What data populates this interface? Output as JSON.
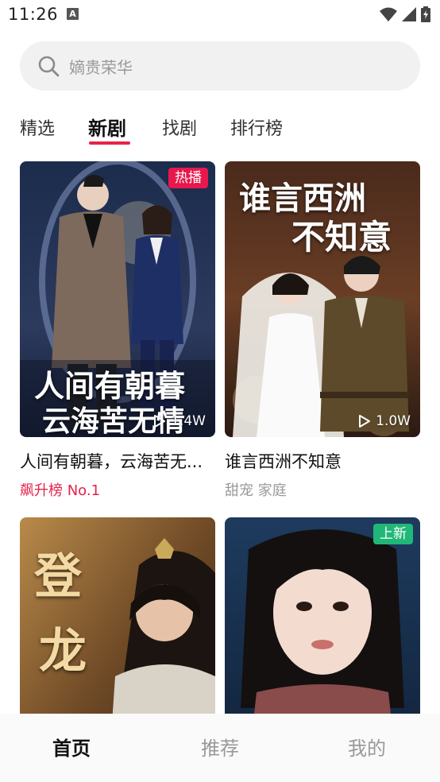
{
  "status_bar": {
    "time": "11:26",
    "a_icon": "A"
  },
  "search": {
    "placeholder": "嫡贵荣华"
  },
  "tabs": [
    {
      "label": "精选"
    },
    {
      "label": "新剧"
    },
    {
      "label": "找剧"
    },
    {
      "label": "排行榜"
    }
  ],
  "colors": {
    "accent": "#e5234b",
    "hot_badge": "#e8184c",
    "new_badge": "#21b779"
  },
  "cards": [
    {
      "title": "人间有朝暮，云海苦无...",
      "subtitle": "飙升榜 No.1",
      "badge": "热播",
      "plays": "1.4W",
      "poster_text_1": "人间有朝暮",
      "poster_text_2": "云海苦无情"
    },
    {
      "title": "谁言西洲不知意",
      "subtitle": "甜宠 家庭",
      "plays": "1.0W",
      "poster_text_1": "谁言西洲",
      "poster_text_2": "不知意"
    },
    {
      "poster_text_1": "登",
      "poster_text_2": "龙"
    },
    {
      "badge": "上新"
    }
  ],
  "bottom_nav": [
    {
      "label": "首页"
    },
    {
      "label": "推荐"
    },
    {
      "label": "我的"
    }
  ]
}
